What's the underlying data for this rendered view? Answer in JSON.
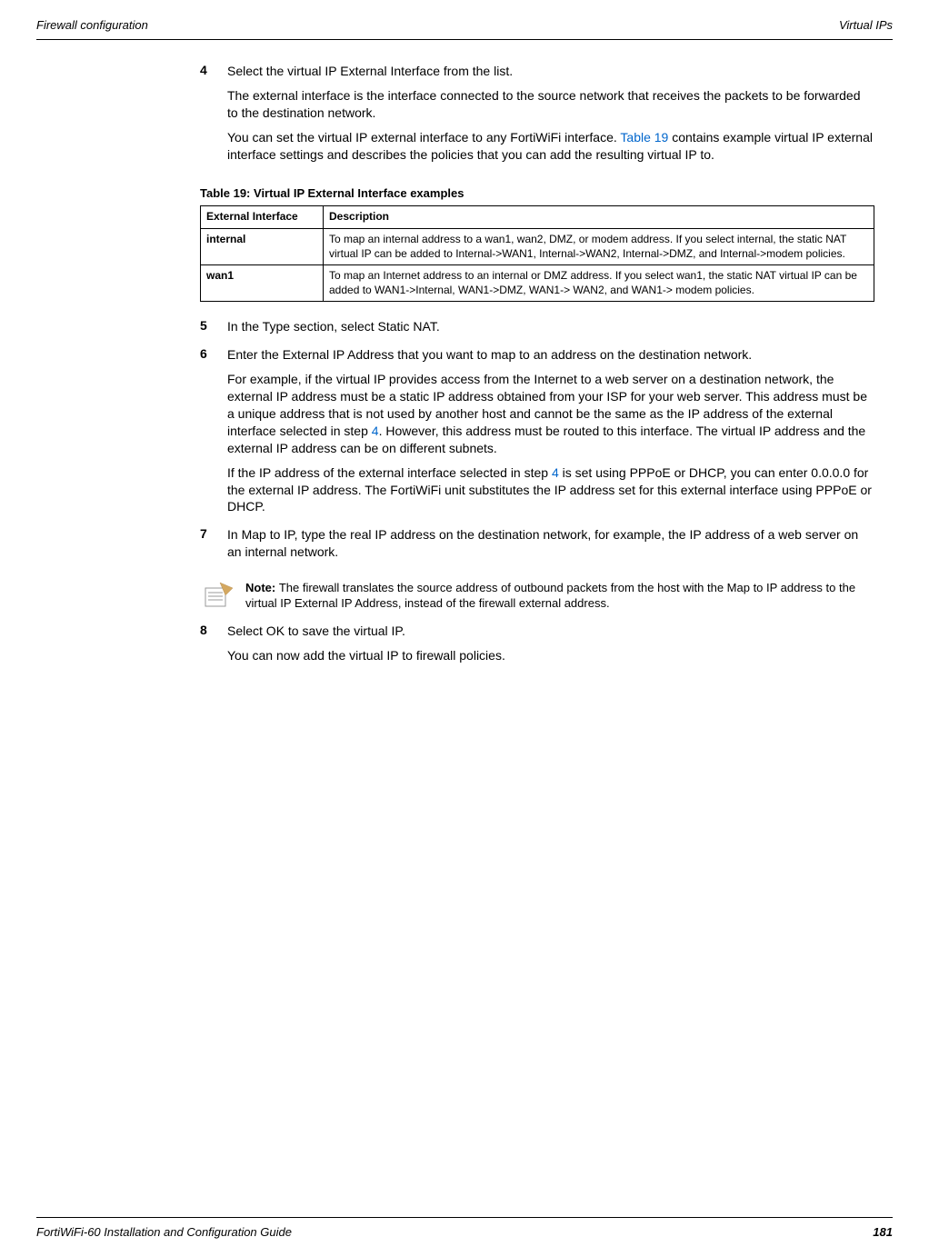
{
  "header": {
    "left": "Firewall configuration",
    "right": "Virtual IPs"
  },
  "steps": {
    "s4": {
      "num": "4",
      "line1": "Select the virtual IP External Interface from the list.",
      "line2": "The external interface is the interface connected to the source network that receives the packets to be forwarded to the destination network.",
      "line3a": "You can set the virtual IP external interface to any FortiWiFi interface. ",
      "line3link": "Table 19",
      "line3b": " contains example virtual IP external interface settings and describes the policies that you can add the resulting virtual IP to."
    },
    "s5": {
      "num": "5",
      "line1": "In the Type section, select Static NAT."
    },
    "s6": {
      "num": "6",
      "line1": "Enter the External IP Address that you want to map to an address on the destination network.",
      "line2a": "For example, if the virtual IP provides access from the Internet to a web server on a destination network, the external IP address must be a static IP address obtained from your ISP for your web server. This address must be a unique address that is not used by another host and cannot be the same as the IP address of the external interface selected in step ",
      "line2link": "4",
      "line2b": ". However, this address must be routed to this interface. The virtual IP address and the external IP address can be on different subnets.",
      "line3a": "If the IP address of the external interface selected in step ",
      "line3link": "4",
      "line3b": " is set using PPPoE or DHCP, you can enter 0.0.0.0 for the external IP address. The FortiWiFi unit substitutes the IP address set for this external interface using PPPoE or DHCP."
    },
    "s7": {
      "num": "7",
      "line1": "In Map to IP, type the real IP address on the destination network, for example, the IP address of a web server on an internal network."
    },
    "s8": {
      "num": "8",
      "line1": "Select OK to save the virtual IP.",
      "line2": "You can now add the virtual IP to firewall policies."
    }
  },
  "table": {
    "caption": "Table 19: Virtual IP External Interface examples",
    "headers": {
      "col1": "External Interface",
      "col2": "Description"
    },
    "rows": {
      "r1": {
        "c1": "internal",
        "c2": "To map an internal address to a wan1, wan2, DMZ, or modem address. If you select internal, the static NAT virtual IP can be added to Internal->WAN1, Internal->WAN2, Internal->DMZ, and Internal->modem policies."
      },
      "r2": {
        "c1": "wan1",
        "c2": "To map an Internet address to an internal or DMZ address. If you select wan1, the static NAT virtual IP can be added to WAN1->Internal, WAN1->DMZ, WAN1-> WAN2, and WAN1-> modem policies."
      }
    }
  },
  "note": {
    "label": "Note: ",
    "text": "The firewall translates the source address of outbound packets from the host with the Map to IP address to the virtual IP External IP Address, instead of the firewall external address."
  },
  "footer": {
    "left": "FortiWiFi-60 Installation and Configuration Guide",
    "right": "181"
  }
}
